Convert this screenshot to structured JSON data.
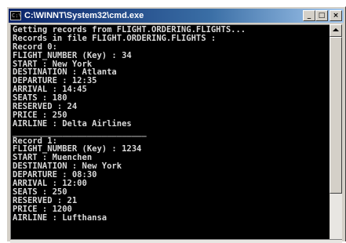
{
  "window": {
    "title": "C:\\WINNT\\System32\\cmd.exe",
    "icon_label": "C:\\",
    "buttons": {
      "minimize": "_",
      "maximize": "□",
      "close": "×"
    }
  },
  "console": {
    "lines": [
      "Getting records from FLIGHT.ORDERING.FLIGHTS...",
      "Records in file FLIGHT.ORDERING.FLIGHTS :",
      "Record 0:",
      "FLIGHT_NUMBER (Key) : 34",
      "START : New York",
      "DESTINATION : Atlanta",
      "DEPARTURE : 12:35",
      "ARRIVAL : 14:45",
      "SEATS : 180",
      "RESERVED : 24",
      "PRICE : 250",
      "AIRLINE : Delta Airlines",
      "___________________________",
      "Record 1:",
      "FLIGHT_NUMBER (Key) : 1234",
      "START : Muenchen",
      "DESTINATION : New York",
      "DEPARTURE : 08:30",
      "ARRIVAL : 12:00",
      "SEATS : 250",
      "RESERVED : 21",
      "PRICE : 1200",
      "AIRLINE : Lufthansa"
    ]
  },
  "colors": {
    "titlebar_start": "#0a246a",
    "titlebar_end": "#a6caf0",
    "console_background": "#000000",
    "console_text": "#d8d8d8"
  }
}
